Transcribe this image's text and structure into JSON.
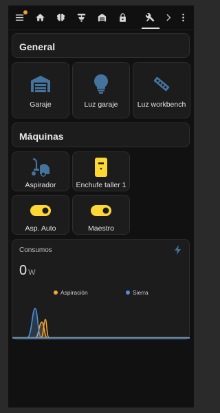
{
  "sections": {
    "general": "General",
    "maquinas": "Máquinas"
  },
  "general_tiles": [
    {
      "label": "Garaje",
      "icon": "garage-door-icon"
    },
    {
      "label": "Luz garaje",
      "icon": "lightbulb-icon"
    },
    {
      "label": "Luz workbench",
      "icon": "led-strip-icon"
    }
  ],
  "machine_tiles": [
    {
      "label": "Aspirador",
      "icon": "vacuum-cleaner-icon"
    },
    {
      "label": "Enchufe taller 1",
      "icon": "power-socket-icon"
    },
    {
      "label": "Asp. Auto",
      "icon": "toggle-on-icon"
    },
    {
      "label": "Maestro",
      "icon": "toggle-on-icon"
    }
  ],
  "consumos": {
    "title": "Consumos",
    "value": "0",
    "unit": "W",
    "legend": [
      {
        "name": "Aspiración",
        "color": "#f0a53a"
      },
      {
        "name": "Sierra",
        "color": "#4a90d9"
      }
    ]
  },
  "colors": {
    "accent_orange": "#f59d2a",
    "icon_blue": "#44739e",
    "icon_yellow": "#fdd835"
  }
}
